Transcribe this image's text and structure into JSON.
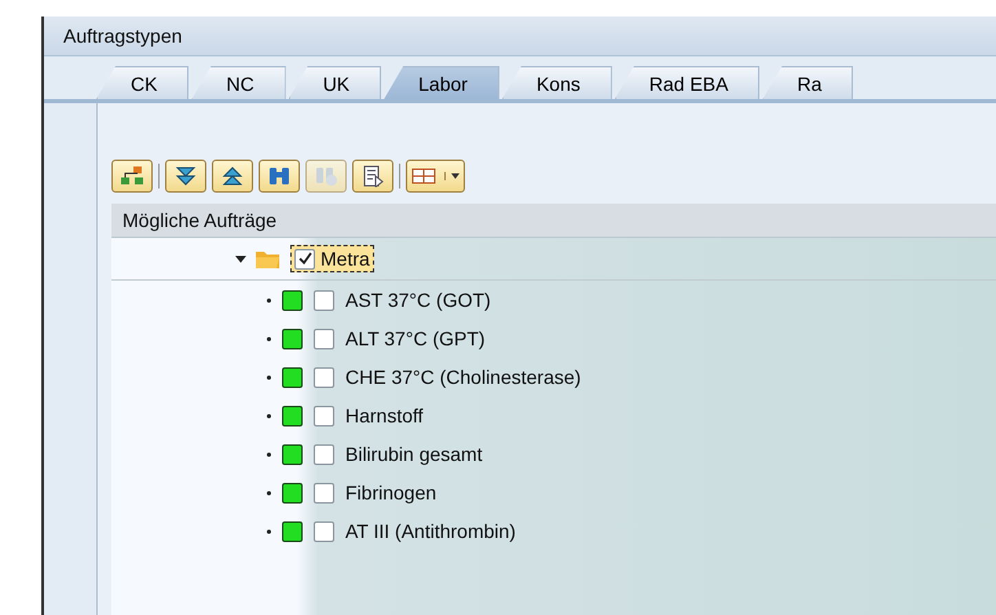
{
  "panel": {
    "title": "Auftragstypen"
  },
  "tabs": [
    {
      "label": "CK",
      "selected": false
    },
    {
      "label": "NC",
      "selected": false
    },
    {
      "label": "UK",
      "selected": false
    },
    {
      "label": "Labor",
      "selected": true
    },
    {
      "label": "Kons",
      "selected": false
    },
    {
      "label": "Rad EBA",
      "selected": false
    },
    {
      "label": "Ra",
      "selected": false
    }
  ],
  "toolbar": [
    {
      "kind": "hierarchy",
      "disabled": false
    },
    {
      "kind": "separator"
    },
    {
      "kind": "expand",
      "disabled": false
    },
    {
      "kind": "collapse",
      "disabled": false
    },
    {
      "kind": "find",
      "disabled": false
    },
    {
      "kind": "findnext",
      "disabled": true
    },
    {
      "kind": "export",
      "disabled": false
    },
    {
      "kind": "separator"
    },
    {
      "kind": "layout",
      "disabled": false
    }
  ],
  "tree": {
    "header": "Mögliche Aufträge",
    "root": {
      "label": "Metra",
      "expanded": true,
      "checked": true,
      "children": [
        {
          "label": "AST 37°C (GOT)",
          "color": "#22dd22",
          "checked": false
        },
        {
          "label": "ALT 37°C (GPT)",
          "color": "#22dd22",
          "checked": false
        },
        {
          "label": "CHE 37°C (Cholinesterase)",
          "color": "#22dd22",
          "checked": false
        },
        {
          "label": "Harnstoff",
          "color": "#22dd22",
          "checked": false
        },
        {
          "label": "Bilirubin gesamt",
          "color": "#22dd22",
          "checked": false
        },
        {
          "label": "Fibrinogen",
          "color": "#22dd22",
          "checked": false
        },
        {
          "label": "AT III (Antithrombin)",
          "color": "#22dd22",
          "checked": false
        }
      ]
    }
  }
}
